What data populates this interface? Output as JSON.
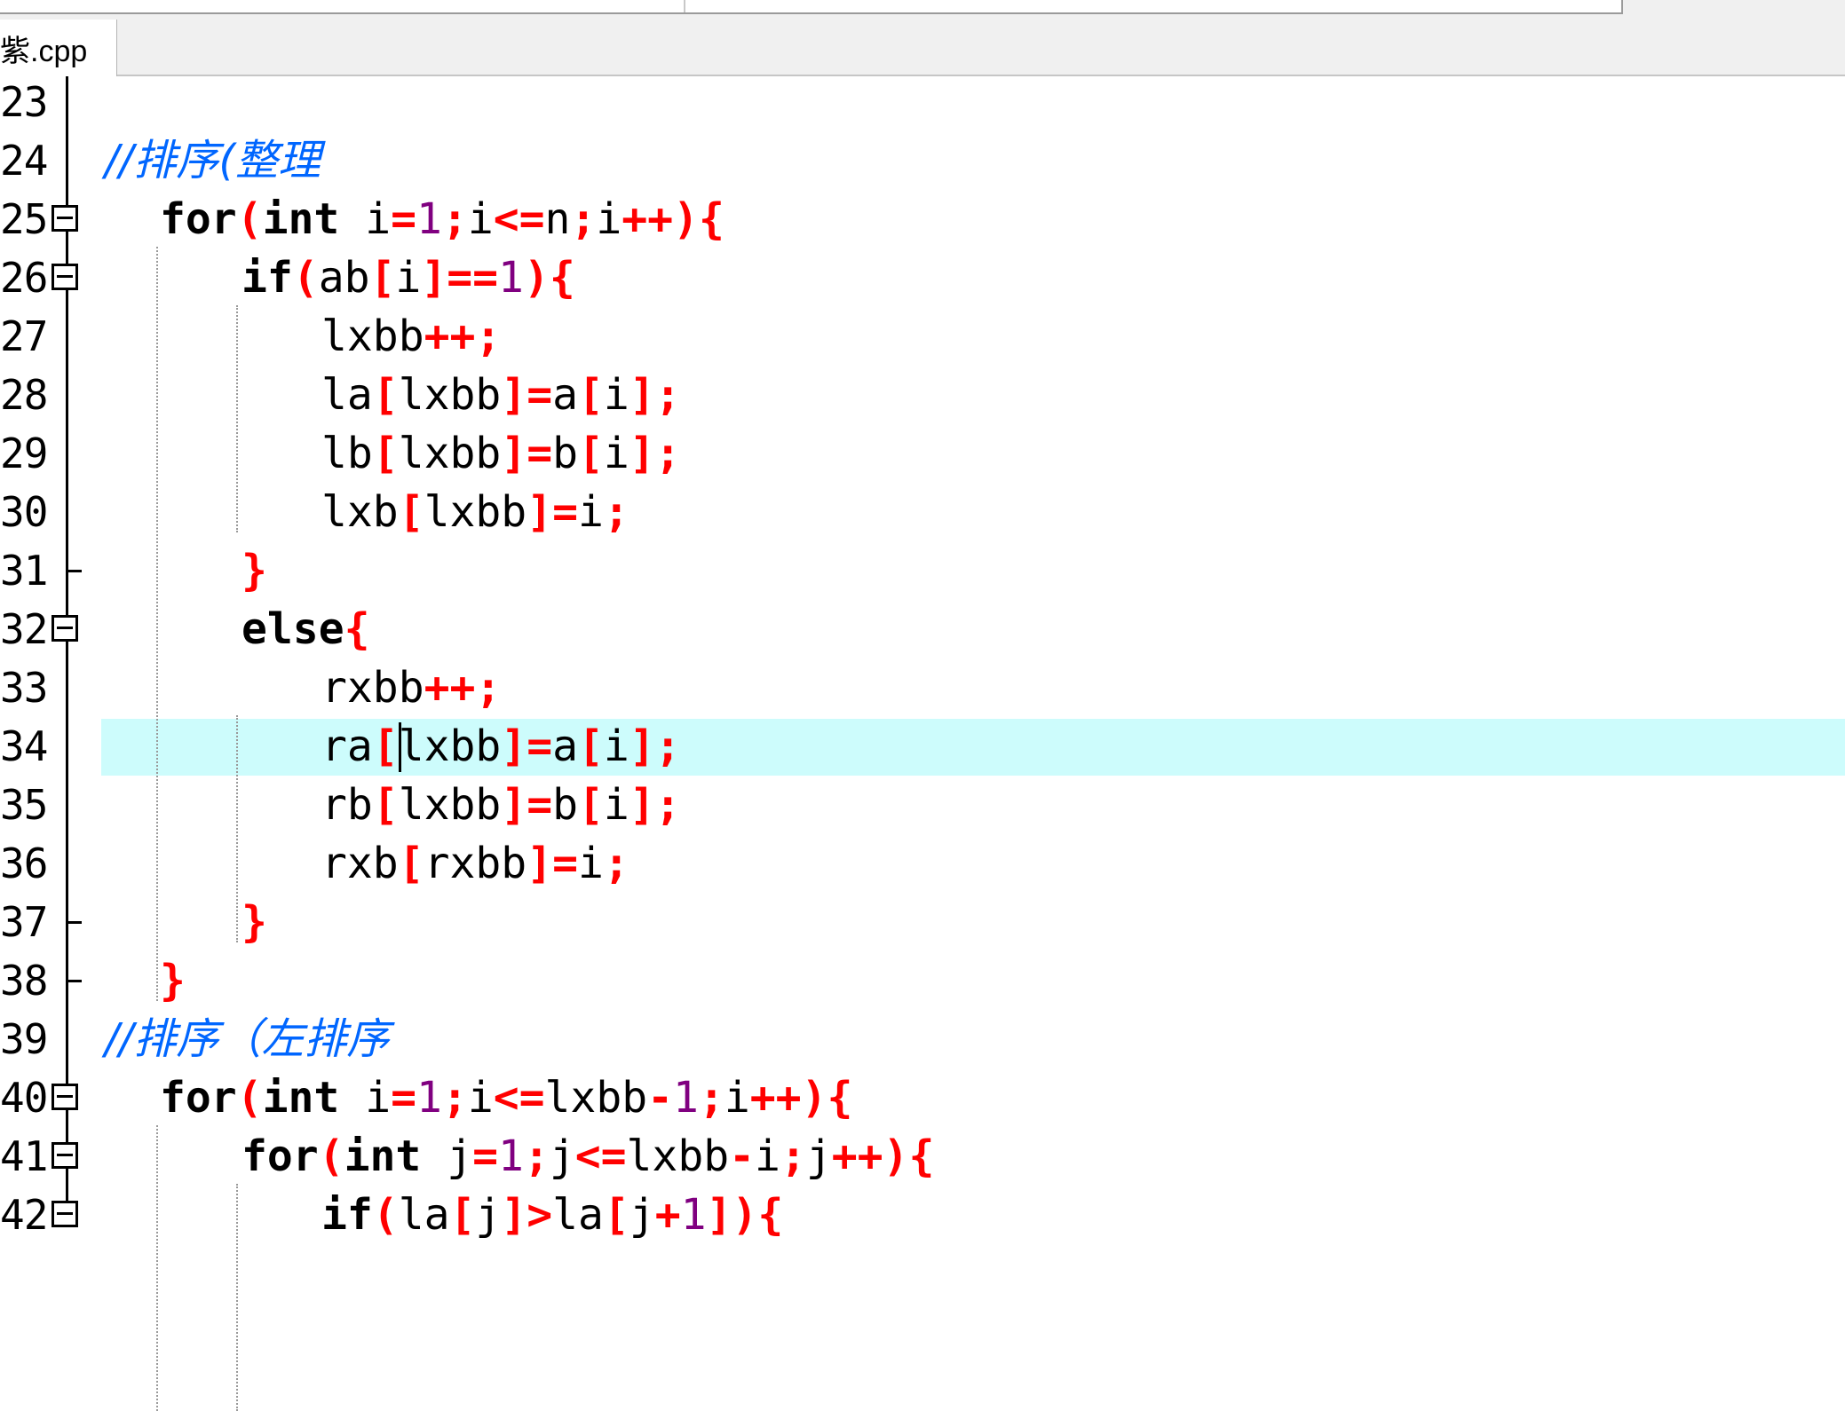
{
  "tab": {
    "title": "紫.cpp"
  },
  "editor": {
    "current_line": "34",
    "lines": [
      {
        "num": "23",
        "tokens": []
      },
      {
        "num": "24",
        "tokens": [
          {
            "t": "//排序(整理",
            "c": "cm"
          }
        ]
      },
      {
        "num": "25",
        "fold": "open",
        "indent": 1,
        "tokens": [
          {
            "t": "for",
            "c": "kw"
          },
          {
            "t": "(",
            "c": "op"
          },
          {
            "t": "int",
            "c": "kw"
          },
          {
            "t": " i"
          },
          {
            "t": "=",
            "c": "op"
          },
          {
            "t": "1",
            "c": "num"
          },
          {
            "t": ";",
            "c": "op"
          },
          {
            "t": "i"
          },
          {
            "t": "<=",
            "c": "op"
          },
          {
            "t": "n"
          },
          {
            "t": ";",
            "c": "op"
          },
          {
            "t": "i"
          },
          {
            "t": "++",
            "c": "op"
          },
          {
            "t": "){",
            "c": "op"
          }
        ]
      },
      {
        "num": "26",
        "fold": "open",
        "indent": 2,
        "tokens": [
          {
            "t": "if",
            "c": "kw"
          },
          {
            "t": "(",
            "c": "op"
          },
          {
            "t": "ab"
          },
          {
            "t": "[",
            "c": "op"
          },
          {
            "t": "i"
          },
          {
            "t": "]==",
            "c": "op"
          },
          {
            "t": "1",
            "c": "num"
          },
          {
            "t": "){",
            "c": "op"
          }
        ]
      },
      {
        "num": "27",
        "indent": 3,
        "tokens": [
          {
            "t": "lxbb"
          },
          {
            "t": "++;",
            "c": "op"
          }
        ]
      },
      {
        "num": "28",
        "indent": 3,
        "tokens": [
          {
            "t": "la"
          },
          {
            "t": "[",
            "c": "op"
          },
          {
            "t": "lxbb"
          },
          {
            "t": "]=",
            "c": "op"
          },
          {
            "t": "a"
          },
          {
            "t": "[",
            "c": "op"
          },
          {
            "t": "i"
          },
          {
            "t": "];",
            "c": "op"
          }
        ]
      },
      {
        "num": "29",
        "indent": 3,
        "tokens": [
          {
            "t": "lb"
          },
          {
            "t": "[",
            "c": "op"
          },
          {
            "t": "lxbb"
          },
          {
            "t": "]=",
            "c": "op"
          },
          {
            "t": "b"
          },
          {
            "t": "[",
            "c": "op"
          },
          {
            "t": "i"
          },
          {
            "t": "];",
            "c": "op"
          }
        ]
      },
      {
        "num": "30",
        "indent": 3,
        "tokens": [
          {
            "t": "lxb"
          },
          {
            "t": "[",
            "c": "op"
          },
          {
            "t": "lxbb"
          },
          {
            "t": "]=",
            "c": "op"
          },
          {
            "t": "i"
          },
          {
            "t": ";",
            "c": "op"
          }
        ]
      },
      {
        "num": "31",
        "fold": "end",
        "indent": 2,
        "tokens": [
          {
            "t": "}",
            "c": "op"
          }
        ]
      },
      {
        "num": "32",
        "fold": "open",
        "indent": 2,
        "tokens": [
          {
            "t": "else",
            "c": "kw"
          },
          {
            "t": "{",
            "c": "op"
          }
        ]
      },
      {
        "num": "33",
        "indent": 3,
        "tokens": [
          {
            "t": "rxbb"
          },
          {
            "t": "++;",
            "c": "op"
          }
        ]
      },
      {
        "num": "34",
        "indent": 3,
        "tokens": [
          {
            "t": "ra"
          },
          {
            "t": "[",
            "c": "op"
          },
          {
            "t": "lxbb"
          },
          {
            "t": "]=",
            "c": "op"
          },
          {
            "t": "a"
          },
          {
            "t": "[",
            "c": "op"
          },
          {
            "t": "i"
          },
          {
            "t": "];",
            "c": "op"
          }
        ]
      },
      {
        "num": "35",
        "indent": 3,
        "tokens": [
          {
            "t": "rb"
          },
          {
            "t": "[",
            "c": "op"
          },
          {
            "t": "lxbb"
          },
          {
            "t": "]=",
            "c": "op"
          },
          {
            "t": "b"
          },
          {
            "t": "[",
            "c": "op"
          },
          {
            "t": "i"
          },
          {
            "t": "];",
            "c": "op"
          }
        ]
      },
      {
        "num": "36",
        "indent": 3,
        "tokens": [
          {
            "t": "rxb"
          },
          {
            "t": "[",
            "c": "op"
          },
          {
            "t": "rxbb"
          },
          {
            "t": "]=",
            "c": "op"
          },
          {
            "t": "i"
          },
          {
            "t": ";",
            "c": "op"
          }
        ]
      },
      {
        "num": "37",
        "fold": "end",
        "indent": 2,
        "tokens": [
          {
            "t": "}",
            "c": "op"
          }
        ]
      },
      {
        "num": "38",
        "fold": "end",
        "indent": 1,
        "tokens": [
          {
            "t": "}",
            "c": "op"
          }
        ]
      },
      {
        "num": "39",
        "tokens": [
          {
            "t": "//排序（左排序",
            "c": "cm"
          }
        ]
      },
      {
        "num": "40",
        "fold": "open",
        "indent": 1,
        "tokens": [
          {
            "t": "for",
            "c": "kw"
          },
          {
            "t": "(",
            "c": "op"
          },
          {
            "t": "int",
            "c": "kw"
          },
          {
            "t": " i"
          },
          {
            "t": "=",
            "c": "op"
          },
          {
            "t": "1",
            "c": "num"
          },
          {
            "t": ";",
            "c": "op"
          },
          {
            "t": "i"
          },
          {
            "t": "<=",
            "c": "op"
          },
          {
            "t": "lxbb"
          },
          {
            "t": "-",
            "c": "op"
          },
          {
            "t": "1",
            "c": "num"
          },
          {
            "t": ";",
            "c": "op"
          },
          {
            "t": "i"
          },
          {
            "t": "++",
            "c": "op"
          },
          {
            "t": "){",
            "c": "op"
          }
        ]
      },
      {
        "num": "41",
        "fold": "open",
        "indent": 2,
        "tokens": [
          {
            "t": "for",
            "c": "kw"
          },
          {
            "t": "(",
            "c": "op"
          },
          {
            "t": "int",
            "c": "kw"
          },
          {
            "t": " j"
          },
          {
            "t": "=",
            "c": "op"
          },
          {
            "t": "1",
            "c": "num"
          },
          {
            "t": ";",
            "c": "op"
          },
          {
            "t": "j"
          },
          {
            "t": "<=",
            "c": "op"
          },
          {
            "t": "lxbb"
          },
          {
            "t": "-",
            "c": "op"
          },
          {
            "t": "i"
          },
          {
            "t": ";",
            "c": "op"
          },
          {
            "t": "j"
          },
          {
            "t": "++",
            "c": "op"
          },
          {
            "t": "){",
            "c": "op"
          }
        ]
      },
      {
        "num": "42",
        "fold": "open",
        "indent": 3,
        "tokens": [
          {
            "t": "if",
            "c": "kw"
          },
          {
            "t": "(",
            "c": "op"
          },
          {
            "t": "la"
          },
          {
            "t": "[",
            "c": "op"
          },
          {
            "t": "j"
          },
          {
            "t": "]>",
            "c": "op"
          },
          {
            "t": "la"
          },
          {
            "t": "[",
            "c": "op"
          },
          {
            "t": "j"
          },
          {
            "t": "+",
            "c": "op"
          },
          {
            "t": "1",
            "c": "num"
          },
          {
            "t": "]){",
            "c": "op"
          }
        ]
      }
    ]
  }
}
